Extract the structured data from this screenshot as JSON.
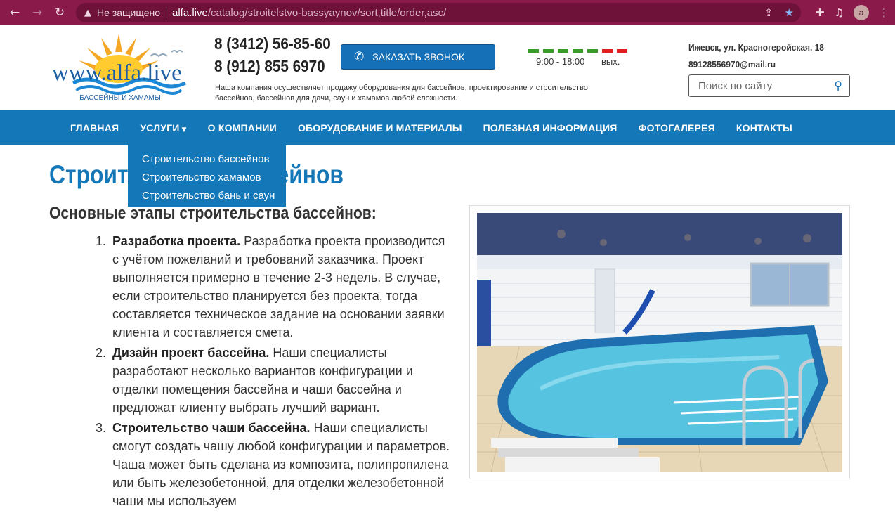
{
  "browser": {
    "insecure_label": "Не защищено",
    "url_host": "alfa.live",
    "url_path": "/catalog/stroitelstvo-bassyaynov/sort,title/order,asc/",
    "profile_initial": "a"
  },
  "header": {
    "logo_text": "www.alfa.live",
    "logo_subtitle": "БАССЕЙНЫ И ХАМАМЫ",
    "phone1": "8 (3412) 56-85-60",
    "phone2": "8 (912) 855 6970",
    "tagline": "Наша компания осуществляет продажу оборудования для бассейнов, проектирование и строительство бассейнов, бассейнов для дачи, саун и хамамов любой сложности.",
    "callback_label": "ЗАКАЗАТЬ ЗВОНОК",
    "hours": "9:00 - 18:00",
    "day_off": "вых.",
    "week_colors": [
      "#3a9a2a",
      "#3a9a2a",
      "#3a9a2a",
      "#3a9a2a",
      "#3a9a2a",
      "#e02020",
      "#e02020"
    ],
    "address": "Ижевск, ул. Красногеройская, 18",
    "email": "89128556970@mail.ru",
    "search_placeholder": "Поиск по сайту"
  },
  "nav": {
    "items": [
      "ГЛАВНАЯ",
      "УСЛУГИ",
      "О КОМПАНИИ",
      "ОБОРУДОВАНИЕ И МАТЕРИАЛЫ",
      "ПОЛЕЗНАЯ ИНФОРМАЦИЯ",
      "ФОТОГАЛЕРЕЯ",
      "КОНТАКТЫ"
    ],
    "dropdown": [
      "Строительство бассейнов",
      "Строительство хамамов",
      "Строительство бань и саун"
    ]
  },
  "content": {
    "title": "Строительство бассейнов",
    "subheading": "Основные этапы строительства бассейнов:",
    "steps": [
      {
        "num": "1.",
        "title": "Разработка проекта.",
        "text": " Разработка проекта производится с учётом пожеланий и требований заказчика. Проект выполняется примерно в течение 2-3 недель. В случае, если строительство планируется без проекта, тогда составляется техническое задание на основании заявки клиента и составляется смета."
      },
      {
        "num": "2.",
        "title": "Дизайн проект бассейна.",
        "text": " Наши специалисты разработают несколько вариантов конфигурации и отделки помещения бассейна и чаши бассейна и предложат клиенту выбрать лучший вариант."
      },
      {
        "num": "3.",
        "title": "Строительство чаши бассейна.",
        "text": " Наши специалисты смогут создать чашу любой конфигурации и параметров. Чаша может быть сделана из композита, полипропилена или быть железобетонной, для отделки железобетонной чаши мы используем"
      }
    ]
  },
  "colors": {
    "brand_blue": "#1478b8",
    "chrome": "#8a1a4a"
  }
}
